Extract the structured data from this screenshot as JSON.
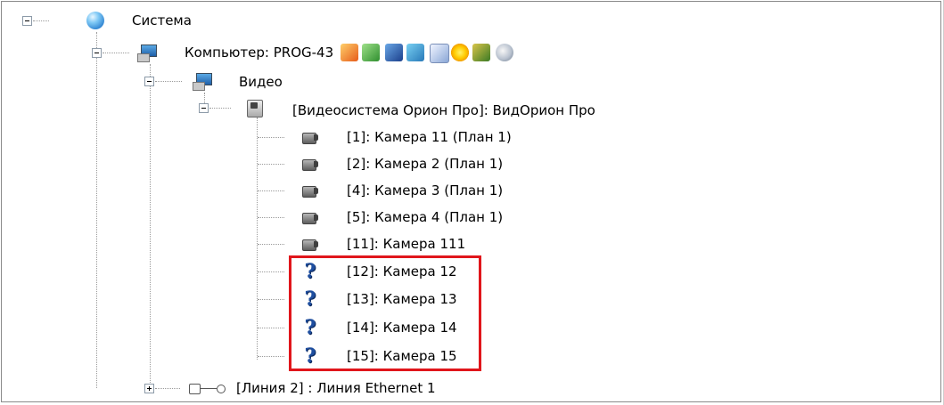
{
  "tree": {
    "root": {
      "label": "Система",
      "icon": "globe-icon",
      "expanded": true
    },
    "computer": {
      "label": "Компьютер: PROG-43",
      "icon": "computer-icon",
      "expanded": true,
      "toolbar_icons": [
        "pointer-icon",
        "green-monitor-icon",
        "blue-cpu-icon",
        "notes-icon",
        "document-icon",
        "sun-icon",
        "users-icon",
        "disk-icon"
      ]
    },
    "video": {
      "label": "Видео",
      "icon": "monitor-icon",
      "expanded": true
    },
    "video_system": {
      "label": "[Видеосистема Орион Про]: ВидОрион Про",
      "icon": "video-system-icon",
      "expanded": true
    },
    "cameras": [
      {
        "label": "[1]: Камера 11 (План 1)",
        "icon": "camera-icon"
      },
      {
        "label": "[2]: Камера 2 (План 1)",
        "icon": "camera-icon"
      },
      {
        "label": "[4]: Камера 3 (План 1)",
        "icon": "camera-icon"
      },
      {
        "label": "[5]: Камера 4 (План 1)",
        "icon": "camera-icon"
      },
      {
        "label": "[11]: Камера 111",
        "icon": "camera-icon"
      },
      {
        "label": "[12]: Камера 12",
        "icon": "question-icon",
        "q": "?"
      },
      {
        "label": "[13]: Камера 13",
        "icon": "question-icon",
        "q": "?"
      },
      {
        "label": "[14]: Камера 14",
        "icon": "question-icon",
        "q": "?"
      },
      {
        "label": "[15]: Камера 15",
        "icon": "question-icon",
        "q": "?"
      }
    ],
    "line": {
      "label": "[Линия 2] : Линия Ethernet 1",
      "icon": "line-icon",
      "expanded": false
    }
  },
  "colors": {
    "highlight": "#e0161b",
    "question": "#1f4fa0"
  }
}
